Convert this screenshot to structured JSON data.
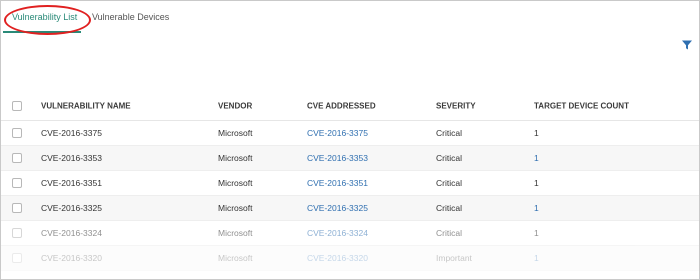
{
  "tabs": [
    {
      "label": "Vulnerability List",
      "active": true
    },
    {
      "label": "Vulnerable Devices",
      "active": false
    }
  ],
  "toolbar": {
    "filter_icon": "filter-icon",
    "accent": "#2a8a78",
    "highlight": "#e02020"
  },
  "table": {
    "headers": [
      "VULNERABILITY NAME",
      "VENDOR",
      "CVE ADDRESSED",
      "SEVERITY",
      "TARGET DEVICE COUNT"
    ],
    "rows": [
      {
        "name": "CVE-2016-3375",
        "vendor": "Microsoft",
        "cve": "CVE-2016-3375",
        "severity": "Critical",
        "count": "1"
      },
      {
        "name": "CVE-2016-3353",
        "vendor": "Microsoft",
        "cve": "CVE-2016-3353",
        "severity": "Critical",
        "count": "1"
      },
      {
        "name": "CVE-2016-3351",
        "vendor": "Microsoft",
        "cve": "CVE-2016-3351",
        "severity": "Critical",
        "count": "1"
      },
      {
        "name": "CVE-2016-3325",
        "vendor": "Microsoft",
        "cve": "CVE-2016-3325",
        "severity": "Critical",
        "count": "1"
      },
      {
        "name": "CVE-2016-3324",
        "vendor": "Microsoft",
        "cve": "CVE-2016-3324",
        "severity": "Critical",
        "count": "1"
      },
      {
        "name": "CVE-2016-3320",
        "vendor": "Microsoft",
        "cve": "CVE-2016-3320",
        "severity": "Important",
        "count": "1"
      }
    ]
  }
}
